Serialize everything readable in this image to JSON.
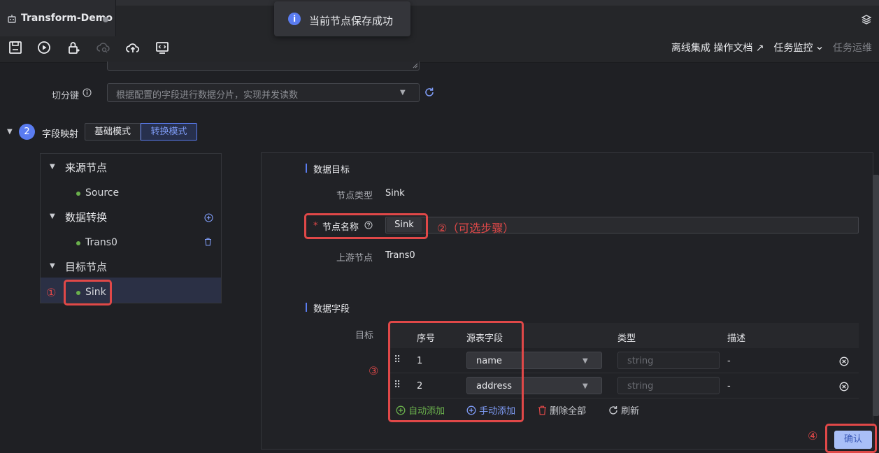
{
  "window": {
    "tab_title": "Transform-Demo"
  },
  "toast": {
    "icon": "info-icon",
    "icon_glyph": "i",
    "message": "当前节点保存成功"
  },
  "toolbar": {
    "icons": [
      "save-icon",
      "run-icon",
      "lock-icon",
      "cloud-search-icon",
      "cloud-upload-icon",
      "code-icon"
    ],
    "links": {
      "offline_integration": "离线集成",
      "docs": "操作文档 ↗",
      "task_monitor": "任务监控",
      "task_ops": "任务运维"
    }
  },
  "config": {
    "split_key_label": "切分键",
    "split_key_placeholder": "根据配置的字段进行数据分片，实现并发读数"
  },
  "section": {
    "number": "2",
    "title": "字段映射",
    "modes": [
      "基础模式",
      "转换模式"
    ],
    "active_mode": "转换模式"
  },
  "tree": {
    "groups": [
      {
        "label": "来源节点",
        "nodes": [
          "Source"
        ]
      },
      {
        "label": "数据转换",
        "nodes": [
          "Trans0"
        ]
      },
      {
        "label": "目标节点",
        "nodes": [
          "Sink"
        ]
      }
    ],
    "selected_node": "Sink"
  },
  "target": {
    "section_title": "数据目标",
    "node_type_label": "节点类型",
    "node_type_value": "Sink",
    "node_name_required": "*",
    "node_name_label": "节点名称",
    "node_name_value": "Sink",
    "upstream_label": "上游节点",
    "upstream_value": "Trans0"
  },
  "fields": {
    "section_title": "数据字段",
    "target_label": "目标",
    "columns": [
      "序号",
      "源表字段",
      "类型",
      "描述"
    ],
    "rows": [
      {
        "index": "1",
        "source": "name",
        "type_placeholder": "string",
        "desc": "-"
      },
      {
        "index": "2",
        "source": "address",
        "type_placeholder": "string",
        "desc": "-"
      }
    ],
    "actions": {
      "auto_add": "自动添加",
      "manual_add": "手动添加",
      "delete_all": "删除全部",
      "refresh": "刷新"
    }
  },
  "annotations": {
    "a1": "①",
    "a2": "②（可选步骤）",
    "a3": "③",
    "a4": "④"
  },
  "confirm_label": "确认",
  "colors": {
    "accent": "#5a7cf0",
    "annotation_red": "#e04848",
    "status_green": "#6ab04c"
  }
}
